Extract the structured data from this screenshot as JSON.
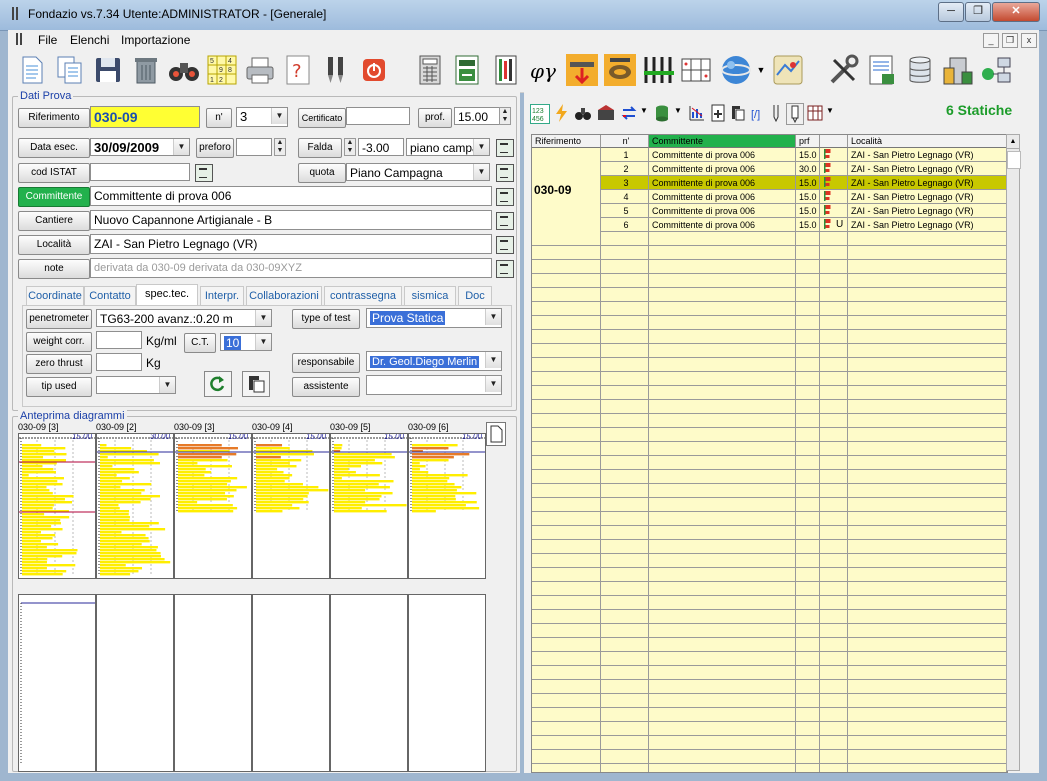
{
  "window": {
    "title": "Fondazio vs.7.34  Utente:ADMINISTRATOR - [Generale]"
  },
  "menu": [
    "File",
    "Elenchi",
    "Importazione"
  ],
  "toolbar_icons": [
    "new-document-icon",
    "copy-document-icon",
    "save-icon",
    "trash-icon",
    "binoculars-icon",
    "sudoku-icon",
    "printer-icon",
    "help-icon",
    "tools-icon",
    "power-icon",
    "calculator-icon",
    "document-export-icon",
    "strip-chart-icon",
    "phi-gamma-icon",
    "foundation-load-icon",
    "foundation-ring-icon",
    "piles-icon",
    "grid-icon",
    "globe-icon",
    "map-icon",
    "settings-tools-icon",
    "report-icon",
    "database-icon",
    "building-icon",
    "network-icon"
  ],
  "dati_prova": {
    "group_label": "Dati Prova",
    "riferimento_label": "Riferimento",
    "riferimento_value": "030-09",
    "n_label": "n'",
    "n_value": "3",
    "certificato_label": "Certificato",
    "certificato_value": "",
    "prof_label": "prof.",
    "prof_value": "15.00",
    "data_label": "Data esec.",
    "data_value": "30/09/2009",
    "preforo_label": "preforo",
    "preforo_value": "",
    "falda_label": "Falda",
    "falda_value": "-3.00",
    "falda_ref": "piano campag",
    "istat_label": "cod ISTAT",
    "istat_value": "",
    "quota_label": "quota",
    "quota_value": "Piano Campagna",
    "committente_label": "Committente",
    "committente_value": "Committente di prova 006",
    "cantiere_label": "Cantiere",
    "cantiere_value": "Nuovo Capannone Artigianale -  B",
    "localita_label": "Località",
    "localita_value": "ZAI - San Pietro Legnago (VR)",
    "note_label": "note",
    "note_value": "derivata da 030-09 derivata da 030-09XYZ"
  },
  "tabs": [
    "Coordinate",
    "Contatto",
    "spec.tec.",
    "Interpr.",
    "Collaborazioni",
    "contrassegna",
    "sismica",
    "Doc"
  ],
  "spec": {
    "penetrometer_label": "penetrometer",
    "penetrometer_value": "TG63-200   avanz.:0.20 m",
    "weight_label": "weight corr.",
    "weight_value": "",
    "weight_unit": "Kg/ml",
    "ct_label": "C.T.",
    "ct_value": "10",
    "zero_label": "zero thrust",
    "zero_value": "",
    "zero_unit": "Kg",
    "tip_label": "tip used",
    "tip_value": "",
    "type_label": "type of test",
    "type_value": "Prova Statica",
    "resp_label": "responsabile",
    "resp_value": "Dr. Geol.Diego Merlin",
    "assist_label": "assistente",
    "assist_value": ""
  },
  "anteprima": {
    "label": "Anteprima diagrammi",
    "items": [
      {
        "title": "030-09 [3]",
        "depth": "15.00"
      },
      {
        "title": "030-09 [2]",
        "depth": "30.00"
      },
      {
        "title": "030-09 [3]",
        "depth": "15.00"
      },
      {
        "title": "030-09 [4]",
        "depth": "15.00"
      },
      {
        "title": "030-09 [5]",
        "depth": "15.00"
      },
      {
        "title": "030-09 [6]",
        "depth": "15.00"
      }
    ]
  },
  "right": {
    "count_label": "6 Statiche",
    "columns": [
      "Riferimento",
      "n'",
      "Committente",
      "prf",
      "",
      "Località"
    ],
    "group_ref": "030-09",
    "rows": [
      {
        "n": "1",
        "committente": "Committente di prova 006",
        "prf": "15.0",
        "localita": "ZAI - San Pietro Legnago (VR)",
        "selected": false
      },
      {
        "n": "2",
        "committente": "Committente di prova 006",
        "prf": "30.0",
        "localita": "ZAI - San Pietro Legnago (VR)",
        "selected": false
      },
      {
        "n": "3",
        "committente": "Committente di prova 006",
        "prf": "15.0",
        "localita": "ZAI - San Pietro Legnago (VR)",
        "selected": true
      },
      {
        "n": "4",
        "committente": "Committente di prova 006",
        "prf": "15.0",
        "localita": "ZAI - San Pietro Legnago (VR)",
        "selected": false
      },
      {
        "n": "5",
        "committente": "Committente di prova 006",
        "prf": "15.0",
        "localita": "ZAI - San Pietro Legnago (VR)",
        "selected": false
      },
      {
        "n": "6",
        "committente": "Committente di prova 006",
        "prf": "15.0",
        "localita": "ZAI - San Pietro Legnago (VR)",
        "selected": false
      }
    ]
  },
  "colors": {
    "selected_row": "#c8c800",
    "grid_bg": "#fefbc9",
    "accent_green": "#22b14c",
    "highlight_yellow": "#ffff33",
    "count_green": "#1c9c2a"
  }
}
